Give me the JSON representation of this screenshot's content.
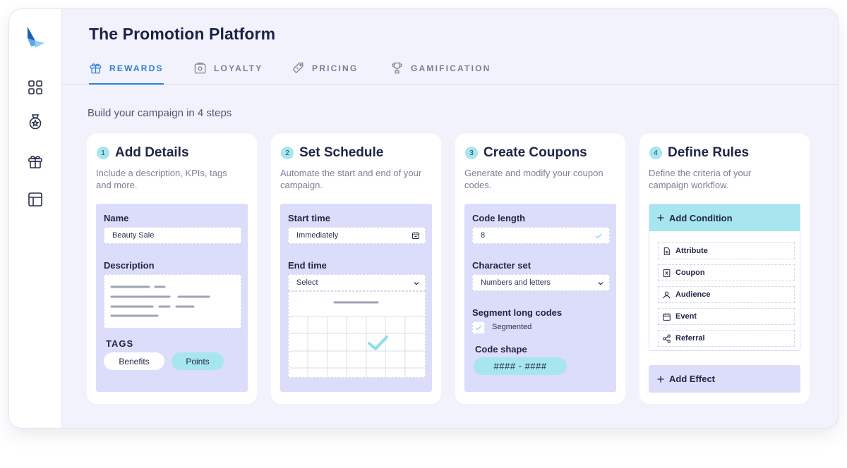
{
  "app": {
    "title": "The Promotion Platform"
  },
  "sidebar": {
    "items": [
      {
        "icon": "grid-icon"
      },
      {
        "icon": "medal-icon"
      },
      {
        "icon": "gift-icon"
      },
      {
        "icon": "layout-icon"
      }
    ]
  },
  "tabs": [
    {
      "label": "REWARDS",
      "icon": "gift-icon",
      "active": true
    },
    {
      "label": "LOYALTY",
      "icon": "bag-icon",
      "active": false
    },
    {
      "label": "PRICING",
      "icon": "tag-icon",
      "active": false
    },
    {
      "label": "GAMIFICATION",
      "icon": "trophy-icon",
      "active": false
    }
  ],
  "subtitle": "Build your campaign in 4 steps",
  "steps": [
    {
      "number": "1",
      "title": "Add Details",
      "description": "Include a description, KPIs, tags and more.",
      "name_label": "Name",
      "name_value": "Beauty Sale",
      "description_label": "Description",
      "tags_label": "TAGS",
      "tags": [
        "Benefits",
        "Points"
      ]
    },
    {
      "number": "2",
      "title": "Set Schedule",
      "description": "Automate the start and end of your campaign.",
      "start_label": "Start time",
      "start_value": "Immediately",
      "end_label": "End time",
      "end_value": "Select"
    },
    {
      "number": "3",
      "title": "Create Coupons",
      "description": "Generate and modify your coupon codes.",
      "code_length_label": "Code length",
      "code_length_value": "8",
      "charset_label": "Character set",
      "charset_value": "Numbers and letters",
      "segment_label": "Segment long codes",
      "segment_option": "Segmented",
      "shape_label": "Code shape",
      "shape_value": "#### - ####"
    },
    {
      "number": "4",
      "title": "Define Rules",
      "description": "Define the criteria of your campaign workflow.",
      "add_condition": "Add Condition",
      "conditions": [
        {
          "label": "Attribute",
          "icon": "attribute-icon"
        },
        {
          "label": "Coupon",
          "icon": "coupon-icon"
        },
        {
          "label": "Audience",
          "icon": "person-icon"
        },
        {
          "label": "Event",
          "icon": "calendar-icon"
        },
        {
          "label": "Referral",
          "icon": "share-icon"
        }
      ],
      "add_effect": "Add Effect"
    }
  ],
  "colors": {
    "accent": "#2d7fd3",
    "panel": "#dcdcfb",
    "cyan": "#a7e6ef",
    "frame_bg": "#f1f2fc"
  }
}
